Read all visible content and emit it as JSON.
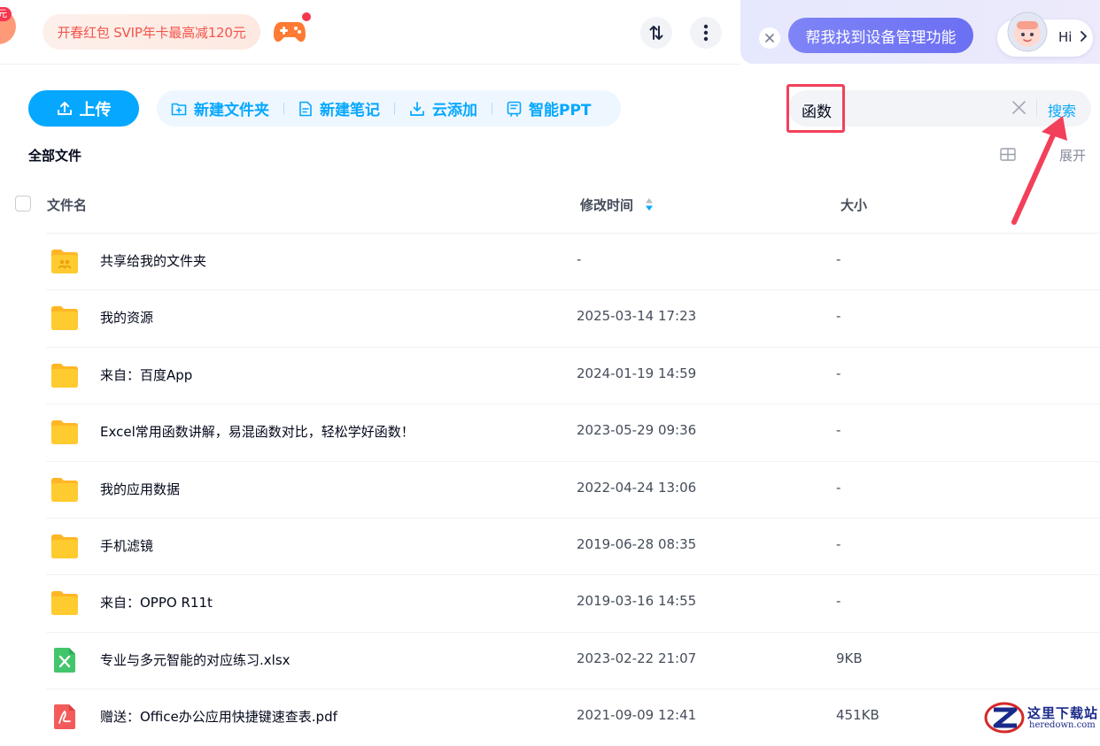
{
  "promo": {
    "corner_badge": "元",
    "label": "开春红包 SVIP年卡最高减120元"
  },
  "assistant": {
    "suggestion": "帮我找到设备管理功能",
    "greeting": "Hi"
  },
  "toolbar": {
    "upload": "上传",
    "actions": [
      {
        "label": "新建文件夹",
        "icon": "folder-add-icon"
      },
      {
        "label": "新建笔记",
        "icon": "note-add-icon"
      },
      {
        "label": "云添加",
        "icon": "cloud-download-icon"
      },
      {
        "label": "智能PPT",
        "icon": "smart-ppt-icon"
      }
    ]
  },
  "search": {
    "value": "函数",
    "button": "搜索"
  },
  "breadcrumb": "全部文件",
  "view": {
    "expand": "展开"
  },
  "table": {
    "columns": {
      "name": "文件名",
      "modified": "修改时间",
      "size": "大小"
    },
    "rows": [
      {
        "name": "共享给我的文件夹",
        "time": "-",
        "size": "-",
        "type": "shared-folder"
      },
      {
        "name": "我的资源",
        "time": "2025-03-14 17:23",
        "size": "-",
        "type": "folder"
      },
      {
        "name": "来自：百度App",
        "time": "2024-01-19 14:59",
        "size": "-",
        "type": "folder"
      },
      {
        "name": "Excel常用函数讲解，易混函数对比，轻松学好函数！",
        "time": "2023-05-29 09:36",
        "size": "-",
        "type": "folder"
      },
      {
        "name": "我的应用数据",
        "time": "2022-04-24 13:06",
        "size": "-",
        "type": "folder"
      },
      {
        "name": "手机滤镜",
        "time": "2019-06-28 08:35",
        "size": "-",
        "type": "folder"
      },
      {
        "name": "来自：OPPO R11t",
        "time": "2019-03-16 14:55",
        "size": "-",
        "type": "folder"
      },
      {
        "name": "专业与多元智能的对应练习.xlsx",
        "time": "2023-02-22 21:07",
        "size": "9KB",
        "type": "xlsx"
      },
      {
        "name": "赠送：Office办公应用快捷键速查表.pdf",
        "time": "2021-09-09 12:41",
        "size": "451KB",
        "type": "pdf"
      }
    ]
  },
  "watermark": {
    "cn": "这里下载站",
    "en": "heredown.com"
  },
  "colors": {
    "accent": "#06a7ff",
    "highlight": "#f2405a",
    "assistant": "#6b6ff2",
    "folder": "#ffcb2f"
  }
}
